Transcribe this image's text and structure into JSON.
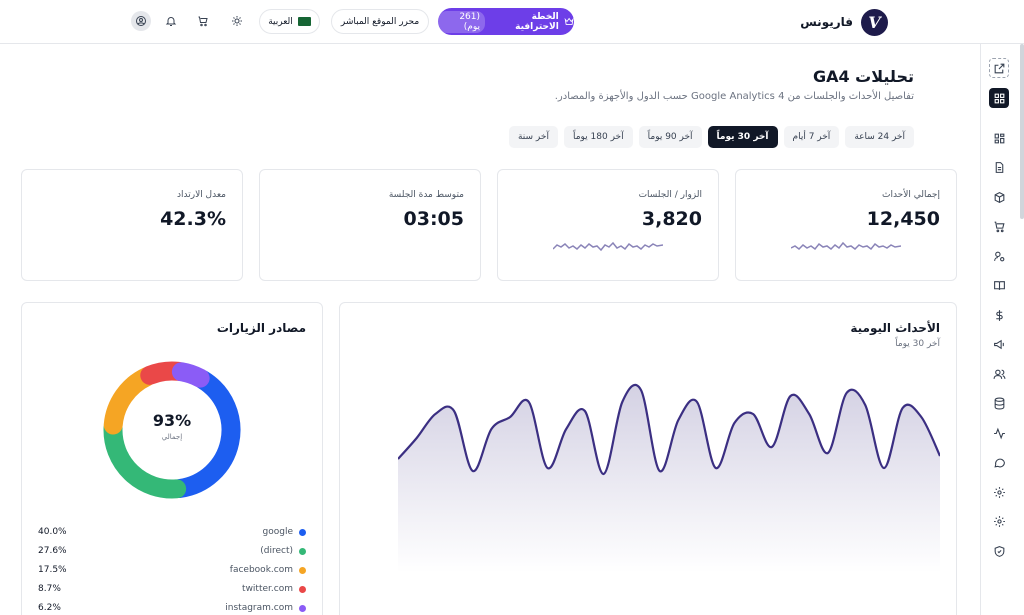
{
  "brand": {
    "name": "فاريونس",
    "logo_letter": "V"
  },
  "topbar": {
    "plan_label": "الخطة الاحترافية",
    "plan_days": "(261 يوم)",
    "editor_label": "محرر الموقع المباشر",
    "language_label": "العربية",
    "icons": [
      "crown-icon",
      "sun-icon",
      "cart-icon",
      "bell-icon",
      "user-icon"
    ]
  },
  "page": {
    "title": "تحليلات GA4",
    "subtitle": "تفاصيل الأحداث والجلسات من Google Analytics 4 حسب الدول والأجهزة والمصادر."
  },
  "ranges": [
    {
      "label": "آخر 24 ساعة",
      "active": false
    },
    {
      "label": "آخر 7 أيام",
      "active": false
    },
    {
      "label": "آخر 30 يوماً",
      "active": true
    },
    {
      "label": "آخر 90 يوماً",
      "active": false
    },
    {
      "label": "آخر 180 يوماً",
      "active": false
    },
    {
      "label": "آخر سنة",
      "active": false
    }
  ],
  "stats": [
    {
      "label": "إجمالي الأحداث",
      "value": "12,450",
      "has_spark": true
    },
    {
      "label": "الزوار / الجلسات",
      "value": "3,820",
      "has_spark": true
    },
    {
      "label": "متوسط مدة الجلسة",
      "value": "03:05",
      "has_spark": false
    },
    {
      "label": "معدل الارتداد",
      "value": "42.3%",
      "has_spark": false
    }
  ],
  "daily_events": {
    "title": "الأحداث اليومية",
    "subtitle": "آخر 30 يوماً"
  },
  "traffic": {
    "title": "مصادر الزيارات",
    "center_value": "93%",
    "center_label": "إجمالي",
    "sources": [
      {
        "name": "google",
        "pct": "40.0%",
        "value": 40.0,
        "color": "#1d5ef0"
      },
      {
        "name": "(direct)",
        "pct": "27.6%",
        "value": 27.6,
        "color": "#34b877"
      },
      {
        "name": "facebook.com",
        "pct": "17.5%",
        "value": 17.5,
        "color": "#f5a524"
      },
      {
        "name": "twitter.com",
        "pct": "8.7%",
        "value": 8.7,
        "color": "#ea4848"
      },
      {
        "name": "instagram.com",
        "pct": "6.2%",
        "value": 6.2,
        "color": "#8b5cf6"
      }
    ]
  },
  "chart_data": {
    "type": "area",
    "title": "الأحداث اليومية",
    "subtitle": "آخر 30 يوماً",
    "xlabel": "",
    "ylabel": "",
    "grid": false,
    "x": [
      1,
      2,
      3,
      4,
      5,
      6,
      7,
      8,
      9,
      10,
      11,
      12,
      13,
      14,
      15,
      16,
      17,
      18,
      19,
      20,
      21,
      22,
      23,
      24,
      25,
      26,
      27,
      28,
      29,
      30
    ],
    "values": [
      330,
      400,
      480,
      490,
      290,
      430,
      470,
      520,
      300,
      430,
      490,
      280,
      520,
      560,
      290,
      460,
      520,
      300,
      450,
      480,
      370,
      540,
      480,
      350,
      550,
      510,
      300,
      500,
      470,
      340
    ],
    "ylim": [
      0,
      600
    ],
    "color": "#3b2f82"
  },
  "sidebar": {
    "icons": [
      "external-link-icon",
      "dashboard-icon",
      "grid-icon",
      "file-icon",
      "box-icon",
      "cart-icon",
      "user-key-icon",
      "book-icon",
      "dollar-icon",
      "megaphone-icon",
      "users-icon",
      "database-icon",
      "activity-icon",
      "chat-icon",
      "settings-icon",
      "settings-icon",
      "shield-icon"
    ]
  }
}
